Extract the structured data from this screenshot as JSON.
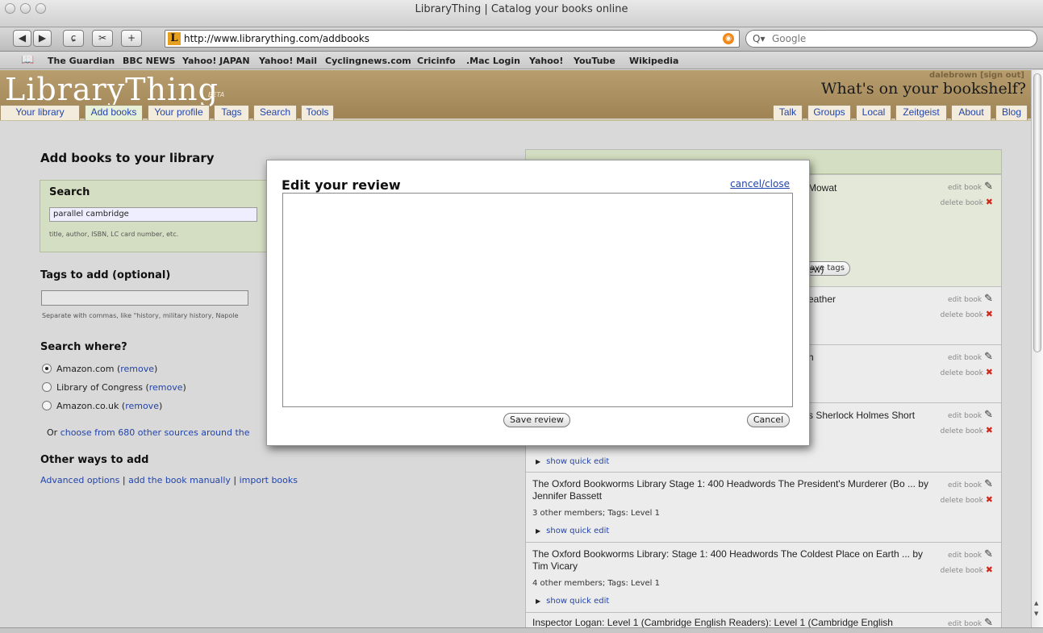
{
  "window": {
    "title": "LibraryThing | Catalog your books online"
  },
  "toolbar": {
    "back_label": "◀",
    "forward_label": "▶",
    "reload_label": "ɕ",
    "snap_label": "✂",
    "add_label": "+",
    "url": "http://www.librarything.com/addbooks",
    "favicon_letter": "L",
    "search_placeholder": "Google"
  },
  "bookmarks": [
    "The Guardian",
    "BBC NEWS",
    "Yahoo! JAPAN",
    "Yahoo! Mail",
    "Cyclingnews.com",
    "Cricinfo",
    ".Mac Login",
    "Yahoo!",
    "YouTube",
    "Wikipedia"
  ],
  "header": {
    "logo": "LibraryThing",
    "beta": "BETA",
    "tagline": "What's on your bookshelf?",
    "signin": "dalebrown [sign out]"
  },
  "nav_left": [
    "Your library",
    "Add books",
    "Your profile",
    "Tags",
    "Search",
    "Tools"
  ],
  "nav_right": [
    "Talk",
    "Groups",
    "Local",
    "Zeitgeist",
    "About",
    "Blog"
  ],
  "left": {
    "heading": "Add books to your library",
    "search_heading": "Search",
    "search_value": "parallel cambridge",
    "search_hint": "title, author, ISBN, LC card number, etc.",
    "tags_heading": "Tags to add (optional)",
    "tags_value": "",
    "tags_hint": "Separate with commas, like \"history, military history, Napole",
    "where_heading": "Search where?",
    "sources": [
      {
        "name": "Amazon.com",
        "remove": "remove",
        "selected": true
      },
      {
        "name": "Library of Congress",
        "remove": "remove",
        "selected": false
      },
      {
        "name": "Amazon.co.uk",
        "remove": "remove",
        "selected": false
      }
    ],
    "choose_prefix": "Or",
    "choose_link": "choose from 680 other sources around the",
    "other_heading": "Other ways to add",
    "other_links": [
      "Advanced options",
      "add the book manually",
      "import books"
    ],
    "sep": "|",
    "paren_open": "(",
    "paren_close": ")"
  },
  "books": {
    "edit_label": "edit book",
    "delete_label": "delete book",
    "quick_edit_label": "show quick edit",
    "partials": [
      "Mowat",
      "ave tags",
      "ew)",
      "eather",
      "h",
      "s Sherlock Holmes Short"
    ],
    "items": [
      {
        "title": "The Oxford Bookworms Library Stage 1: 400 Headwords The President's Murderer (Bo ... by Jennifer Bassett",
        "meta": "3 other members; Tags: Level 1"
      },
      {
        "title": "The Oxford Bookworms Library: Stage 1: 400 Headwords The Coldest Place on Earth ... by Tim Vicary",
        "meta": "4 other members; Tags: Level 1"
      },
      {
        "title": "Inspector Logan: Level 1 (Cambridge English Readers): Level 1 (Cambridge English"
      }
    ]
  },
  "modal": {
    "title": "Edit your review",
    "cancel_link": "cancel/close",
    "textarea_value": "",
    "save_label": "Save review",
    "cancel_label": "Cancel"
  }
}
